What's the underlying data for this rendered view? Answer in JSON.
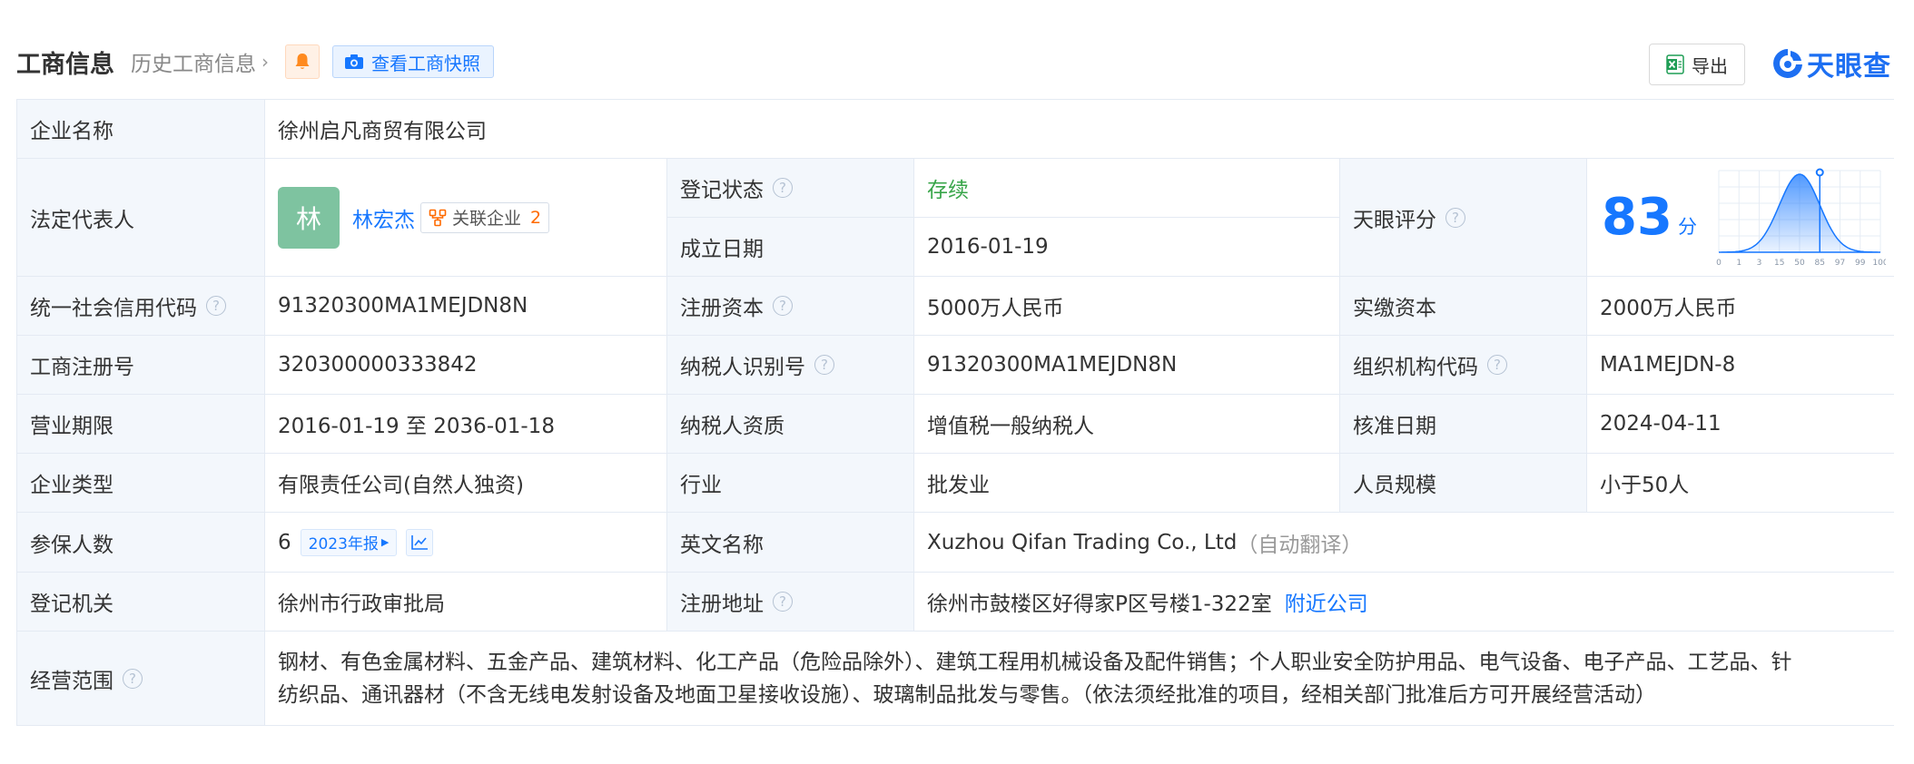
{
  "header": {
    "title": "工商信息",
    "history_label": "历史工商信息",
    "history_chevron": "›",
    "snapshot_label": "查看工商快照",
    "export_label": "导出",
    "logo_text": "天眼查",
    "colors": {
      "accent": "#1677ff",
      "bell": "#ff8a1f",
      "excel": "#1f9d55"
    },
    "icons": [
      "bell-icon",
      "camera-icon",
      "excel-icon",
      "tianyancha-logo-icon"
    ]
  },
  "company": {
    "name_label": "企业名称",
    "name": "徐州启凡商贸有限公司",
    "legal_rep_label": "法定代表人",
    "avatar_char": "林",
    "legal_rep_name": "林宏杰",
    "related_label": "关联企业",
    "related_count": "2",
    "reg_status_label": "登记状态",
    "reg_status": "存续",
    "founded_label": "成立日期",
    "founded": "2016-01-19",
    "score_label": "天眼评分",
    "score": "83",
    "score_unit": "分",
    "credit_code_label": "统一社会信用代码",
    "credit_code": "91320300MA1MEJDN8N",
    "reg_capital_label": "注册资本",
    "reg_capital": "5000万人民币",
    "paid_capital_label": "实缴资本",
    "paid_capital": "2000万人民币",
    "reg_no_label": "工商注册号",
    "reg_no": "320300000333842",
    "taxpayer_id_label": "纳税人识别号",
    "taxpayer_id": "91320300MA1MEJDN8N",
    "org_code_label": "组织机构代码",
    "org_code": "MA1MEJDN-8",
    "term_label": "营业期限",
    "term": "2016-01-19 至 2036-01-18",
    "taxpayer_qual_label": "纳税人资质",
    "taxpayer_qual": "增值税一般纳税人",
    "approved_label": "核准日期",
    "approved": "2024-04-11",
    "type_label": "企业类型",
    "type": "有限责任公司(自然人独资)",
    "industry_label": "行业",
    "industry": "批发业",
    "staff_label": "人员规模",
    "staff": "小于50人",
    "insured_label": "参保人数",
    "insured": "6",
    "report_tag": "2023年报",
    "english_name_label": "英文名称",
    "english_name": "Xuzhou Qifan Trading Co., Ltd",
    "english_name_note": "（自动翻译）",
    "authority_label": "登记机关",
    "authority": "徐州市行政审批局",
    "address_label": "注册地址",
    "address": "徐州市鼓楼区好得家P区号楼1-322室",
    "nearby_label": "附近公司",
    "scope_label": "经营范围",
    "scope_line1": "钢材、有色金属材料、五金产品、建筑材料、化工产品（危险品除外）、建筑工程用机械设备及配件销售；个人职业安全防护用品、电气设备、电子产品、工艺品、针",
    "scope_line2": "纺织品、通讯器材（不含无线电发射设备及地面卫星接收设施）、玻璃制品批发与零售。（依法须经批准的项目，经相关部门批准后方可开展经营活动）",
    "help_glyph": "?"
  },
  "chart_data": {
    "type": "area",
    "x": [
      "0",
      "1",
      "3",
      "15",
      "50",
      "85",
      "97",
      "99",
      "100"
    ],
    "marker": "85",
    "title": "",
    "xlabel": "",
    "ylabel": "",
    "color": "#1677ff"
  }
}
